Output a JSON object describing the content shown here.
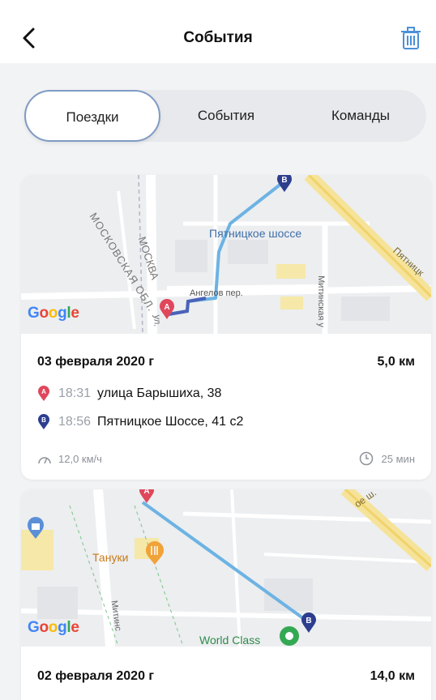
{
  "header": {
    "title": "События"
  },
  "tabs": [
    {
      "label": "Поездки",
      "active": true
    },
    {
      "label": "События",
      "active": false
    },
    {
      "label": "Команды",
      "active": false
    }
  ],
  "trips": [
    {
      "date": "03 февраля 2020 г",
      "distance": "5,0 км",
      "start": {
        "marker": "A",
        "time": "18:31",
        "address": "улица Барышиха, 38"
      },
      "end": {
        "marker": "B",
        "time": "18:56",
        "address": "Пятницкое Шоссе, 41 с2"
      },
      "speed": "12,0 км/ч",
      "duration": "25 мин",
      "map_labels": [
        "Пятницкое шоссе",
        "Ангелов пер.",
        "МОСКОВСКАЯ ОБЛ.",
        "МОСКВА",
        "Митинская у",
        "Пятницк",
        "ул."
      ]
    },
    {
      "date": "02 февраля 2020 г",
      "distance": "14,0 км",
      "map_labels": [
        "Тануки",
        "World Class",
        "Митинс",
        "ое ш."
      ]
    }
  ],
  "map_brand": "Google",
  "colors": {
    "route": "#6db3e3",
    "pin_a": "#e0475b",
    "pin_b": "#2d3e8f",
    "accent": "#4a90d9"
  }
}
